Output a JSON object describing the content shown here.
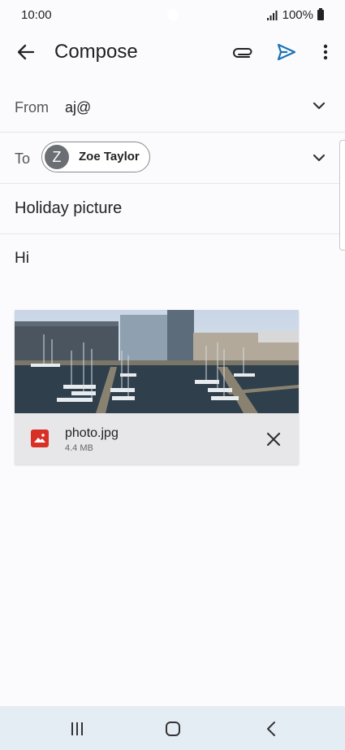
{
  "status": {
    "time": "10:00",
    "battery": "100%"
  },
  "app_bar": {
    "title": "Compose"
  },
  "from": {
    "label": "From",
    "value": "aj@"
  },
  "to": {
    "label": "To",
    "recipient_initial": "Z",
    "recipient_name": "Zoe Taylor"
  },
  "subject": "Holiday picture",
  "body": "Hi",
  "attachment": {
    "file_name": "photo.jpg",
    "file_size": "4.4 MB"
  },
  "colors": {
    "accent": "#1a73b8",
    "file_icon": "#d93025",
    "nav_bar": "#e4ecf4"
  },
  "icons": [
    "back-arrow",
    "paperclip",
    "send",
    "more-vertical",
    "chevron-down",
    "image-file",
    "close",
    "recents",
    "home",
    "nav-back"
  ]
}
